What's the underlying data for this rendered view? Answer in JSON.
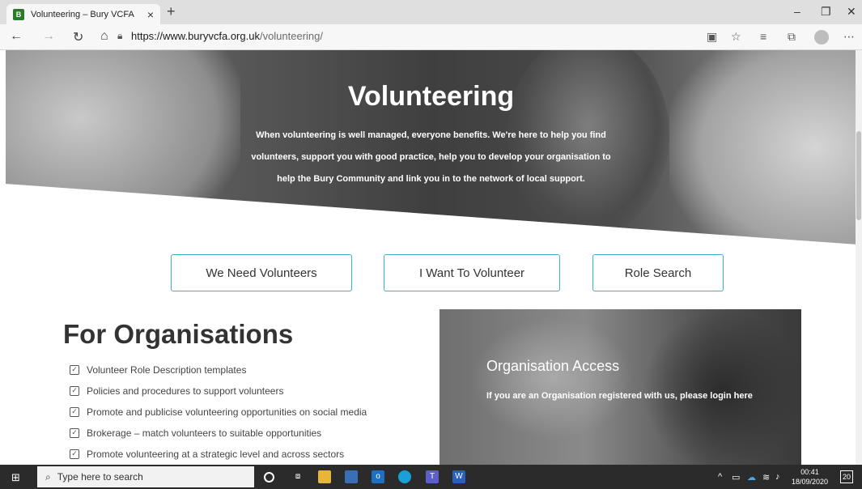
{
  "browser": {
    "tab_title": "Volunteering – Bury VCFA",
    "favicon_label": "B",
    "tab_close": "×",
    "new_tab": "+",
    "url_host": "https://www.buryvcfa.org.uk",
    "url_path": "/volunteering/",
    "window_minimize": "–",
    "window_restore": "❐",
    "window_close": "✕"
  },
  "hero": {
    "title": "Volunteering",
    "text": "When volunteering is well managed, everyone benefits. We're here to help you find volunteers, support you with good practice, help you to develop your organisation to help the Bury Community and link you in to the network of local support."
  },
  "buttons": {
    "need": "We Need Volunteers",
    "want": "I Want To Volunteer",
    "search": "Role Search"
  },
  "organisations": {
    "title": "For Organisations",
    "items": [
      "Volunteer Role Description templates",
      "Policies and procedures to support volunteers",
      "Promote and publicise volunteering opportunities on social media",
      "Brokerage – match volunteers to suitable opportunities",
      "Promote volunteering at a strategic level and across sectors"
    ]
  },
  "access": {
    "title": "Organisation Access",
    "text": "If you are an Organisation registered with us, please login here"
  },
  "taskbar": {
    "search_placeholder": "Type here to search",
    "time": "00:41",
    "date": "18/09/2020",
    "notifications": "20"
  }
}
